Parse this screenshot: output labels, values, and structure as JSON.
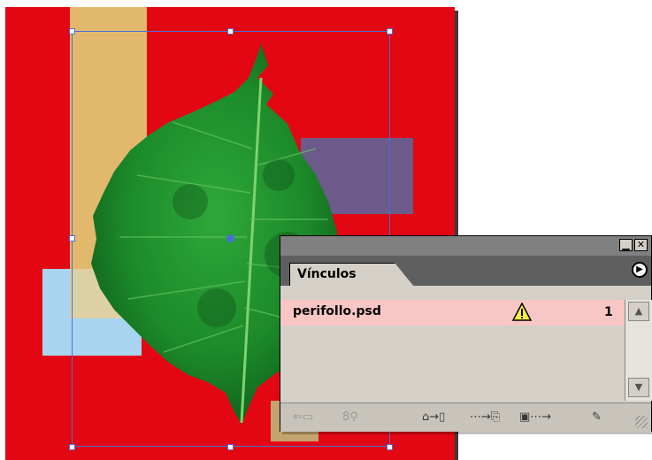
{
  "panel": {
    "tab_label": "Vínculos",
    "links": [
      {
        "name": "perifollo.psd",
        "status_icon": "warning-triangle-icon",
        "page": "1"
      }
    ],
    "toolbar_icons": [
      "relink-to-cms-icon",
      "find-link-icon",
      "relink-icon",
      "go-to-link-icon",
      "update-link-icon",
      "edit-original-icon"
    ]
  },
  "canvas": {
    "selected_image": "perifollo.psd",
    "colors": {
      "page": "#e30613",
      "tan": "#e2b96c",
      "light_blue": "#a8d4ef",
      "purple": "#6b5a8a",
      "selection": "#4a6ed8",
      "link_row": "#f9c6c6"
    }
  }
}
